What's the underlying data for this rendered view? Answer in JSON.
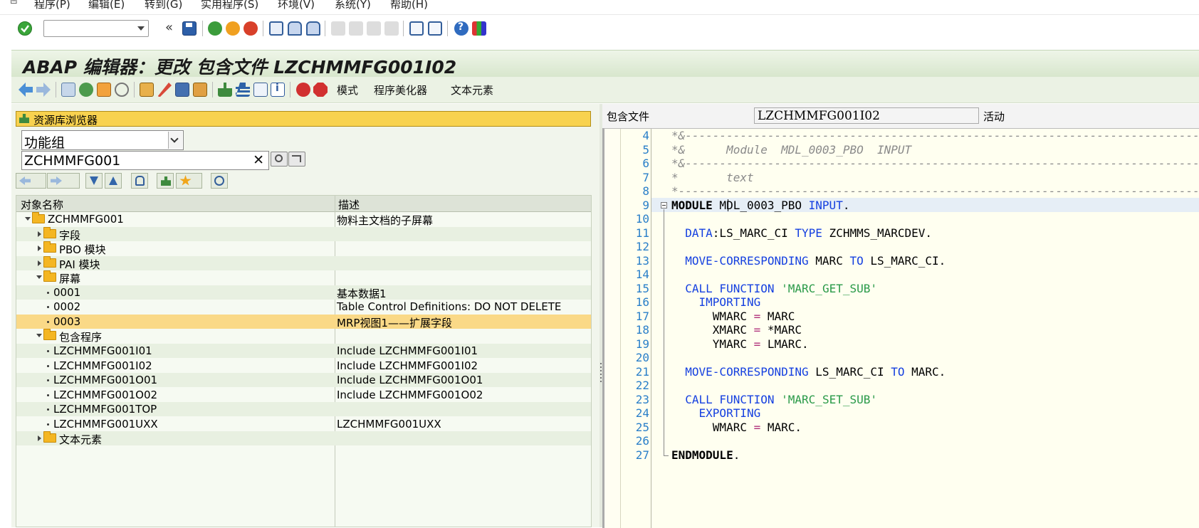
{
  "menu": {
    "items": [
      "程序(P)",
      "编辑(E)",
      "转到(G)",
      "实用程序(S)",
      "环境(V)",
      "系统(Y)",
      "帮助(H)"
    ]
  },
  "toolbar": {
    "command_field_value": "",
    "back_glyph": "«"
  },
  "title": "ABAP 编辑器：更改 包含文件 LZCHMMFG001I02",
  "app_toolbar": {
    "mode_label": "模式",
    "pretty_printer_label": "程序美化器",
    "text_elements_label": "文本元素"
  },
  "repository_browser": {
    "header": "资源库浏览器",
    "object_type": "功能组",
    "object_name": "ZCHMMFG001",
    "clear_glyph": "✕",
    "columns": [
      "对象名称",
      "描述"
    ],
    "rows": [
      {
        "name": "ZCHMMFG001",
        "desc": "物料主文档的子屏幕",
        "level": 0,
        "kind": "folder-open"
      },
      {
        "name": "字段",
        "desc": "",
        "level": 1,
        "kind": "folder"
      },
      {
        "name": "PBO 模块",
        "desc": "",
        "level": 1,
        "kind": "folder"
      },
      {
        "name": "PAI 模块",
        "desc": "",
        "level": 1,
        "kind": "folder"
      },
      {
        "name": "屏幕",
        "desc": "",
        "level": 1,
        "kind": "folder-open"
      },
      {
        "name": "0001",
        "desc": "基本数据1",
        "level": 2,
        "kind": "leaf"
      },
      {
        "name": "0002",
        "desc": "Table Control Definitions: DO NOT DELETE",
        "level": 2,
        "kind": "leaf"
      },
      {
        "name": "0003",
        "desc": "MRP视图1——扩展字段",
        "level": 2,
        "kind": "leaf",
        "selected": true
      },
      {
        "name": "包含程序",
        "desc": "",
        "level": 1,
        "kind": "folder-open"
      },
      {
        "name": "LZCHMMFG001I01",
        "desc": "Include LZCHMMFG001I01",
        "level": 2,
        "kind": "leaf"
      },
      {
        "name": "LZCHMMFG001I02",
        "desc": "Include LZCHMMFG001I02",
        "level": 2,
        "kind": "leaf"
      },
      {
        "name": "LZCHMMFG001O01",
        "desc": "Include LZCHMMFG001O01",
        "level": 2,
        "kind": "leaf"
      },
      {
        "name": "LZCHMMFG001O02",
        "desc": "Include LZCHMMFG001O02",
        "level": 2,
        "kind": "leaf"
      },
      {
        "name": "LZCHMMFG001TOP",
        "desc": "",
        "level": 2,
        "kind": "leaf"
      },
      {
        "name": "LZCHMMFG001UXX",
        "desc": "LZCHMMFG001UXX",
        "level": 2,
        "kind": "leaf"
      },
      {
        "name": "文本元素",
        "desc": "",
        "level": 1,
        "kind": "folder"
      }
    ]
  },
  "editor_header": {
    "include_label": "包含文件",
    "include_value": "LZCHMMFG001I02",
    "status": "活动"
  },
  "editor": {
    "lines": [
      {
        "n": "4",
        "text": "*&---------------------------------------------------------------------------"
      },
      {
        "n": "5",
        "text": "*&      Module  MDL_0003_PBO  INPUT"
      },
      {
        "n": "6",
        "text": "*&---------------------------------------------------------------------------"
      },
      {
        "n": "7",
        "text": "*       text"
      },
      {
        "n": "8",
        "text": "*----------------------------------------------------------------------------"
      },
      {
        "n": "9",
        "text": "MODULE MDL_0003_PBO INPUT."
      },
      {
        "n": "10",
        "text": ""
      },
      {
        "n": "11",
        "text": "  DATA:LS_MARC_CI TYPE ZCHMMS_MARCDEV."
      },
      {
        "n": "12",
        "text": ""
      },
      {
        "n": "13",
        "text": "  MOVE-CORRESPONDING MARC TO LS_MARC_CI."
      },
      {
        "n": "14",
        "text": ""
      },
      {
        "n": "15",
        "text": "  CALL FUNCTION 'MARC_GET_SUB'"
      },
      {
        "n": "16",
        "text": "    IMPORTING"
      },
      {
        "n": "17",
        "text": "      WMARC = MARC"
      },
      {
        "n": "18",
        "text": "      XMARC = *MARC"
      },
      {
        "n": "19",
        "text": "      YMARC = LMARC."
      },
      {
        "n": "20",
        "text": ""
      },
      {
        "n": "21",
        "text": "  MOVE-CORRESPONDING LS_MARC_CI TO MARC."
      },
      {
        "n": "22",
        "text": ""
      },
      {
        "n": "23",
        "text": "  CALL FUNCTION 'MARC_SET_SUB'"
      },
      {
        "n": "24",
        "text": "    EXPORTING"
      },
      {
        "n": "25",
        "text": "      WMARC = MARC."
      },
      {
        "n": "26",
        "text": ""
      },
      {
        "n": "27",
        "text": "ENDMODULE."
      }
    ]
  }
}
